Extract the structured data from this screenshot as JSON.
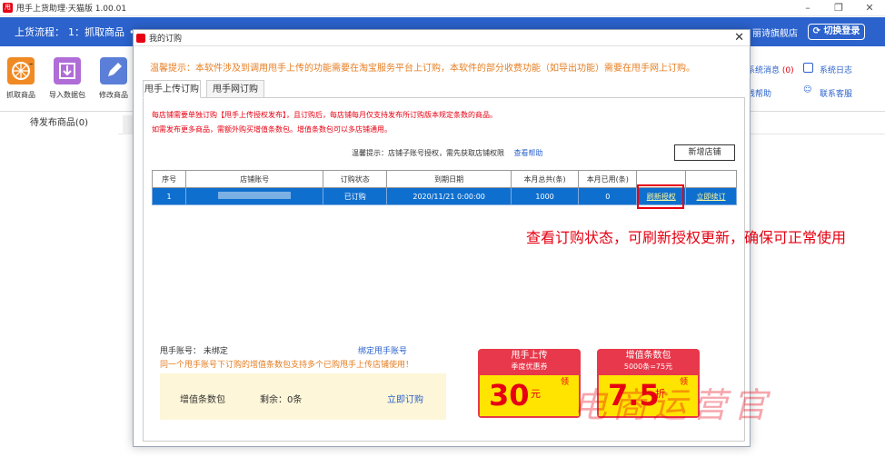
{
  "window": {
    "title": "甩手上货助理·天猫版 1.00.01",
    "controls": [
      "–",
      "❐",
      "✕"
    ]
  },
  "flowbar": {
    "label": "上货流程：",
    "step1": "1：抓取商品",
    "shop_name": "丽诗旗舰店",
    "switch_login": "切换登录"
  },
  "toolbar": {
    "items": [
      {
        "label": "抓取商品",
        "icon": "web-grab-icon",
        "color": "#f08a24"
      },
      {
        "label": "导入数据包",
        "icon": "import-package-icon",
        "color": "#b06dd8"
      },
      {
        "label": "修改商品",
        "icon": "edit-product-icon",
        "color": "#5b7fd8"
      }
    ],
    "right_links": {
      "messages": "系统消息",
      "messages_count": "(0)",
      "syslog": "系统日志",
      "help": "线帮助",
      "support": "联系客服"
    }
  },
  "main_tabs": {
    "pending": "待发布商品(0)"
  },
  "dialog": {
    "title": "我的订购",
    "close": "✕",
    "warm_tip": "温馨提示：本软件涉及到调用甩手上传的功能需要在淘宝服务平台上订购，本软件的部分收费功能（如导出功能）需要在甩手网上订购。",
    "tabs": [
      "甩手上传订购",
      "甩手网订购"
    ],
    "red_lines": [
      "每店铺需要单独订购【甩手上传授权发布】，且订购后，每店铺每月仅支持发布所订购版本规定条数的商品。",
      "如需发布更多商品，需额外购买增值条数包。增值条数包可以多店铺通用。"
    ],
    "tip2": "温馨提示：店铺子账号授权，需先获取店铺权限",
    "tip2_link": "查看帮助",
    "add_shop": "新增店铺",
    "table": {
      "headers": [
        "序号",
        "店铺账号",
        "订购状态",
        "到期日期",
        "本月总共(条)",
        "本月已用(条)",
        "",
        ""
      ],
      "rows": [
        {
          "index": "1",
          "account": "",
          "status": "已订购",
          "expire": "2020/11/21 0:00:00",
          "total": "1000",
          "used": "0",
          "refresh": "刷新授权",
          "renew": "立即续订"
        }
      ]
    },
    "account_label": "甩手账号：",
    "account_value": "未绑定",
    "bind_link": "绑定甩手账号",
    "orange_note": "同一个甩手账号下订购的增值条数包支持多个已购甩手上传店铺使用！",
    "pack": {
      "label": "增值条数包",
      "remaining": "剩余：0条",
      "buy": "立即订购"
    },
    "coupons": [
      {
        "title": "甩手上传",
        "subtitle": "季度优惠券",
        "big": "30",
        "unit": "元",
        "claim": "领"
      },
      {
        "title": "增值条数包",
        "subtitle": "5000条=75元",
        "big": "7.5",
        "unit": "折",
        "claim": "领"
      }
    ]
  },
  "annotation": "查看订购状态，可刷新授权更新，确保可正常使用",
  "watermark": "电商运营官"
}
